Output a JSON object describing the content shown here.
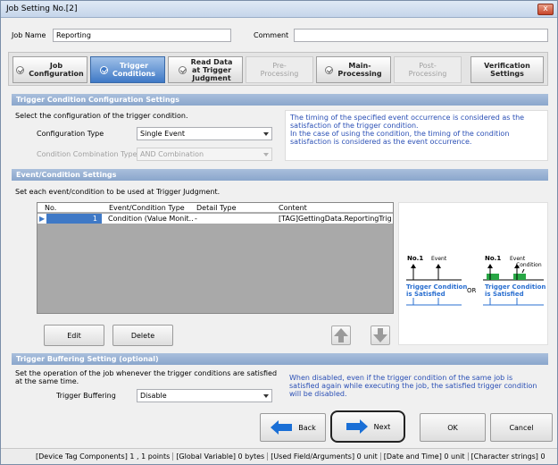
{
  "window": {
    "title": "Job Setting No.[2]",
    "close": "x"
  },
  "job": {
    "name_label": "Job Name",
    "name_value": "Reporting",
    "comment_label": "Comment",
    "comment_value": ""
  },
  "steps": [
    {
      "label": "Job\nConfiguration"
    },
    {
      "label": "Trigger\nConditions"
    },
    {
      "label": "Read Data\nat Trigger\nJudgment"
    },
    {
      "label": "Pre-\nProcessing"
    },
    {
      "label": "Main-\nProcessing"
    },
    {
      "label": "Post-\nProcessing"
    },
    {
      "label": "Verification\nSettings"
    }
  ],
  "trigger_config": {
    "title": "Trigger Condition Configuration Settings",
    "desc": "Select the configuration of the trigger condition.",
    "type_label": "Configuration Type",
    "type_value": "Single Event",
    "comb_label": "Condition Combination Type",
    "comb_value": "AND Combination",
    "info": "The timing of the specified event occurrence is considered as the satisfaction of the trigger condition.\nIn the case of using the condition, the timing of the condition satisfaction is considered as the event occurrence."
  },
  "event_settings": {
    "title": "Event/Condition Settings",
    "desc": "Set each event/condition to be used at Trigger Judgment.",
    "columns": [
      "No.",
      "Event/Condition Type",
      "Detail Type",
      "Content"
    ],
    "rows": [
      {
        "no": "1",
        "type": "Condition (Value Monit...",
        "detail": "-",
        "content": "[TAG]GettingData.ReportingTrig..."
      }
    ],
    "edit": "Edit",
    "delete": "Delete"
  },
  "diagram": {
    "left_no": "No.1",
    "left_event": "Event",
    "left_caption": "Trigger Condition\nis Satisfied",
    "or": "OR",
    "right_no": "No.1",
    "right_event": "Event",
    "right_condition": "Condition",
    "right_caption": "Trigger Condition\nis Satisfied"
  },
  "buffering": {
    "title": "Trigger Buffering Setting (optional)",
    "desc": "Set the operation of the job whenever the trigger conditions are satisfied at the same time.",
    "label": "Trigger Buffering",
    "value": "Disable",
    "info": "When disabled, even if the trigger condition of the same job is satisfied again while executing the job, the satisfied trigger condition will be disabled."
  },
  "buttons": {
    "back": "Back",
    "next": "Next",
    "ok": "OK",
    "cancel": "Cancel"
  },
  "status": [
    "[Device Tag Components] 1 ,  1 points",
    "[Global Variable]  0 bytes",
    "[Used Field/Arguments]  0 unit",
    "[Date and Time]  0 unit",
    "[Character strings]  0"
  ],
  "colors": {
    "accent": "#3f79c6",
    "section": "#8aa6cc",
    "info_text": "#2a4fb5",
    "event_green": "#28a745"
  }
}
